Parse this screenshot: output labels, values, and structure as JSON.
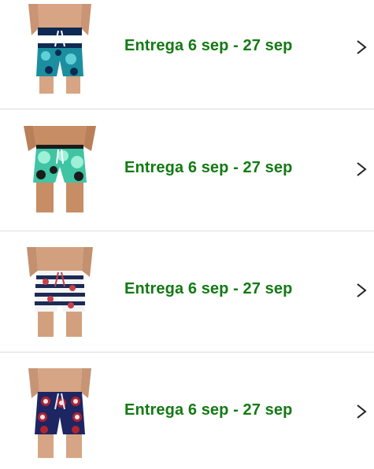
{
  "items": [
    {
      "delivery": "Entrega 6 sep - 27 sep",
      "pattern": "teal-floral-striped-waist",
      "colors": {
        "base": "#1b8fa0",
        "accent": "#0e2a52",
        "print": "#5fd0d6"
      }
    },
    {
      "delivery": "Entrega 6 sep - 27 sep",
      "pattern": "mint-leaf",
      "colors": {
        "base": "#3fc4a4",
        "accent": "#1b1b1b",
        "print": "#9ef0d6"
      }
    },
    {
      "delivery": "Entrega 6 sep - 27 sep",
      "pattern": "navy-white-stripe-floral",
      "colors": {
        "base": "#f4f4f4",
        "accent": "#1d2a55",
        "print": "#c8404a"
      }
    },
    {
      "delivery": "Entrega 6 sep - 27 sep",
      "pattern": "navy-red-target",
      "colors": {
        "base": "#1d2563",
        "accent": "#b0252f",
        "print": "#e8e8f0"
      }
    }
  ],
  "colors": {
    "delivery_text": "#137a13",
    "divider": "#dddddd",
    "chevron": "#222222"
  },
  "icons": {
    "chevron": "chevron-right-icon"
  }
}
